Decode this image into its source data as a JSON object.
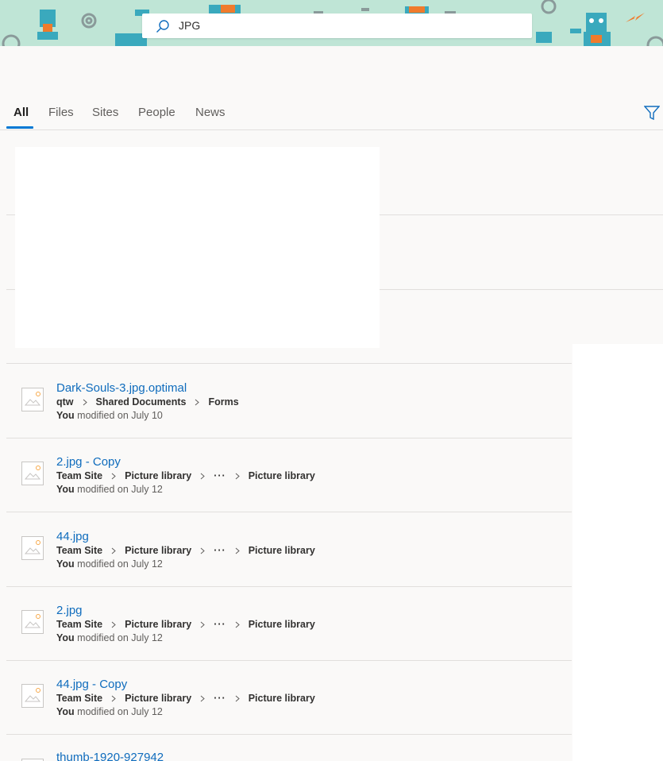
{
  "search": {
    "value": "JPG"
  },
  "tabs": [
    {
      "label": "All",
      "active": true
    },
    {
      "label": "Files",
      "active": false
    },
    {
      "label": "Sites",
      "active": false
    },
    {
      "label": "People",
      "active": false
    },
    {
      "label": "News",
      "active": false
    }
  ],
  "results": [
    {
      "title": "Dark-Souls-3.jpg.optimal",
      "path": [
        "qtw",
        "Shared Documents",
        "Forms"
      ],
      "meta_user": "You",
      "meta_rest": "modified on July 10"
    },
    {
      "title": "2.jpg - Copy",
      "path": [
        "Team Site",
        "Picture library",
        "···",
        "Picture library"
      ],
      "meta_user": "You",
      "meta_rest": "modified on July 12"
    },
    {
      "title": "44.jpg",
      "path": [
        "Team Site",
        "Picture library",
        "···",
        "Picture library"
      ],
      "meta_user": "You",
      "meta_rest": "modified on July 12"
    },
    {
      "title": "2.jpg",
      "path": [
        "Team Site",
        "Picture library",
        "···",
        "Picture library"
      ],
      "meta_user": "You",
      "meta_rest": "modified on July 12"
    },
    {
      "title": "44.jpg - Copy",
      "path": [
        "Team Site",
        "Picture library",
        "···",
        "Picture library"
      ],
      "meta_user": "You",
      "meta_rest": "modified on July 12"
    },
    {
      "title": "thumb-1920-927942"
    }
  ],
  "colors": {
    "accent": "#0078d4",
    "link": "#0f6cbd",
    "banner": "#bfe5d6"
  },
  "icons": [
    "search-icon",
    "filter-icon",
    "image-file-icon",
    "chevron-right-icon",
    "gear-icon",
    "robot-icon",
    "lightning-icon"
  ]
}
